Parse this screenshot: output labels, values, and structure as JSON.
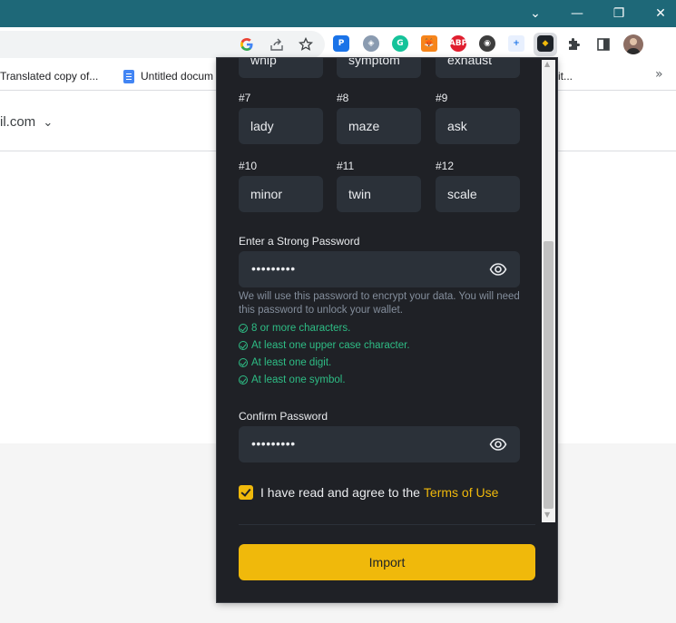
{
  "window_controls": {
    "dropdown": "⌄",
    "minimize": "—",
    "restore": "❐",
    "close": "✕"
  },
  "toolbar": {
    "icons": [
      "google-icon",
      "share-icon",
      "bookmark-star-icon"
    ],
    "extensions": [
      "passwordmanager",
      "ghostery",
      "grammarly",
      "metamask",
      "adblock-plus",
      "extension",
      "extension-add",
      "binance-wallet",
      "extensions-puzzle",
      "side-panel",
      "profile-avatar"
    ]
  },
  "bookmarks": {
    "items": [
      {
        "label": "Translated copy of..."
      },
      {
        "label": "Untitled docum"
      }
    ],
    "truncated_tail": "it...",
    "more": "»"
  },
  "page": {
    "account_fragment": "il.com"
  },
  "popup": {
    "partial_words": [
      "whip",
      "symptom",
      "exhaust"
    ],
    "words": [
      {
        "num": "#7",
        "word": "lady"
      },
      {
        "num": "#8",
        "word": "maze"
      },
      {
        "num": "#9",
        "word": "ask"
      },
      {
        "num": "#10",
        "word": "minor"
      },
      {
        "num": "#11",
        "word": "twin"
      },
      {
        "num": "#12",
        "word": "scale"
      }
    ],
    "password_label": "Enter a Strong Password",
    "password_value": "•••••••••",
    "hint": "We will use this password to encrypt your data. You will need this password to unlock your wallet.",
    "rules": [
      "8 or more characters.",
      "At least one upper case character.",
      "At least one digit.",
      "At least one symbol."
    ],
    "confirm_label": "Confirm Password",
    "confirm_value": "•••••••••",
    "agree_text": "I have read and agree to the",
    "terms_link": "Terms of Use",
    "import_label": "Import"
  },
  "colors": {
    "accent": "#f0b90b",
    "success": "#2ebd85",
    "popup_bg": "#1f2126",
    "field_bg": "#2b3139",
    "titlebar": "#1e6878"
  }
}
